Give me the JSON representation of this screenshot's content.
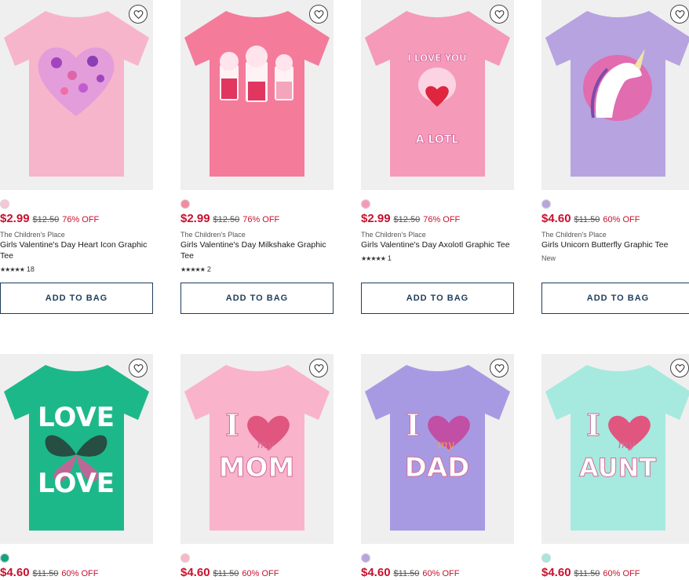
{
  "products": [
    {
      "brand": "The Children's Place",
      "name": "Girls Valentine's Day Heart Icon Graphic Tee",
      "price": "$2.99",
      "original_price": "$12.50",
      "discount": "76% OFF",
      "swatch_color": "#f7c6d5",
      "shirt_color": "#f7b5cc",
      "rating_count": "18",
      "badge": "",
      "add_label": "ADD TO BAG"
    },
    {
      "brand": "The Children's Place",
      "name": "Girls Valentine's Day Milkshake Graphic Tee",
      "price": "$2.99",
      "original_price": "$12.50",
      "discount": "76% OFF",
      "swatch_color": "#f28aa0",
      "shirt_color": "#f57b9a",
      "rating_count": "2",
      "badge": "",
      "add_label": "ADD TO BAG"
    },
    {
      "brand": "The Children's Place",
      "name": "Girls Valentine's Day Axolotl Graphic Tee",
      "price": "$2.99",
      "original_price": "$12.50",
      "discount": "76% OFF",
      "swatch_color": "#f49ab8",
      "shirt_color": "#f59ab9",
      "rating_count": "1",
      "badge": "",
      "add_label": "ADD TO BAG"
    },
    {
      "brand": "The Children's Place",
      "name": "Girls Unicorn Butterfly Graphic Tee",
      "price": "$4.60",
      "original_price": "$11.50",
      "discount": "60% OFF",
      "swatch_color": "#b7a5dc",
      "shirt_color": "#b7a3e0",
      "rating_count": "",
      "badge": "New",
      "add_label": "ADD TO BAG"
    },
    {
      "price": "$4.60",
      "original_price": "$11.50",
      "discount": "60% OFF",
      "swatch_color": "#12a47e",
      "shirt_color": "#1db889",
      "graphic_text": "LOVE LOVE"
    },
    {
      "price": "$4.60",
      "original_price": "$11.50",
      "discount": "60% OFF",
      "swatch_color": "#f7b8c8",
      "shirt_color": "#f9b3cb",
      "graphic_text": "I my MOM"
    },
    {
      "price": "$4.60",
      "original_price": "$11.50",
      "discount": "60% OFF",
      "swatch_color": "#b7a5dc",
      "shirt_color": "#a89ae2",
      "graphic_text": "I my DAD"
    },
    {
      "price": "$4.60",
      "original_price": "$11.50",
      "discount": "60% OFF",
      "swatch_color": "#a8e6dc",
      "shirt_color": "#a6e9df",
      "graphic_text": "I my AUNT"
    }
  ],
  "graphics": [
    "",
    "",
    "I LOVE YOU A LOTL",
    "",
    "LOVE LOVE",
    "I my MOM",
    "I my DAD",
    "I my AUNT"
  ],
  "icons": {
    "favorite": "heart-outline-icon",
    "star": "star-icon"
  }
}
